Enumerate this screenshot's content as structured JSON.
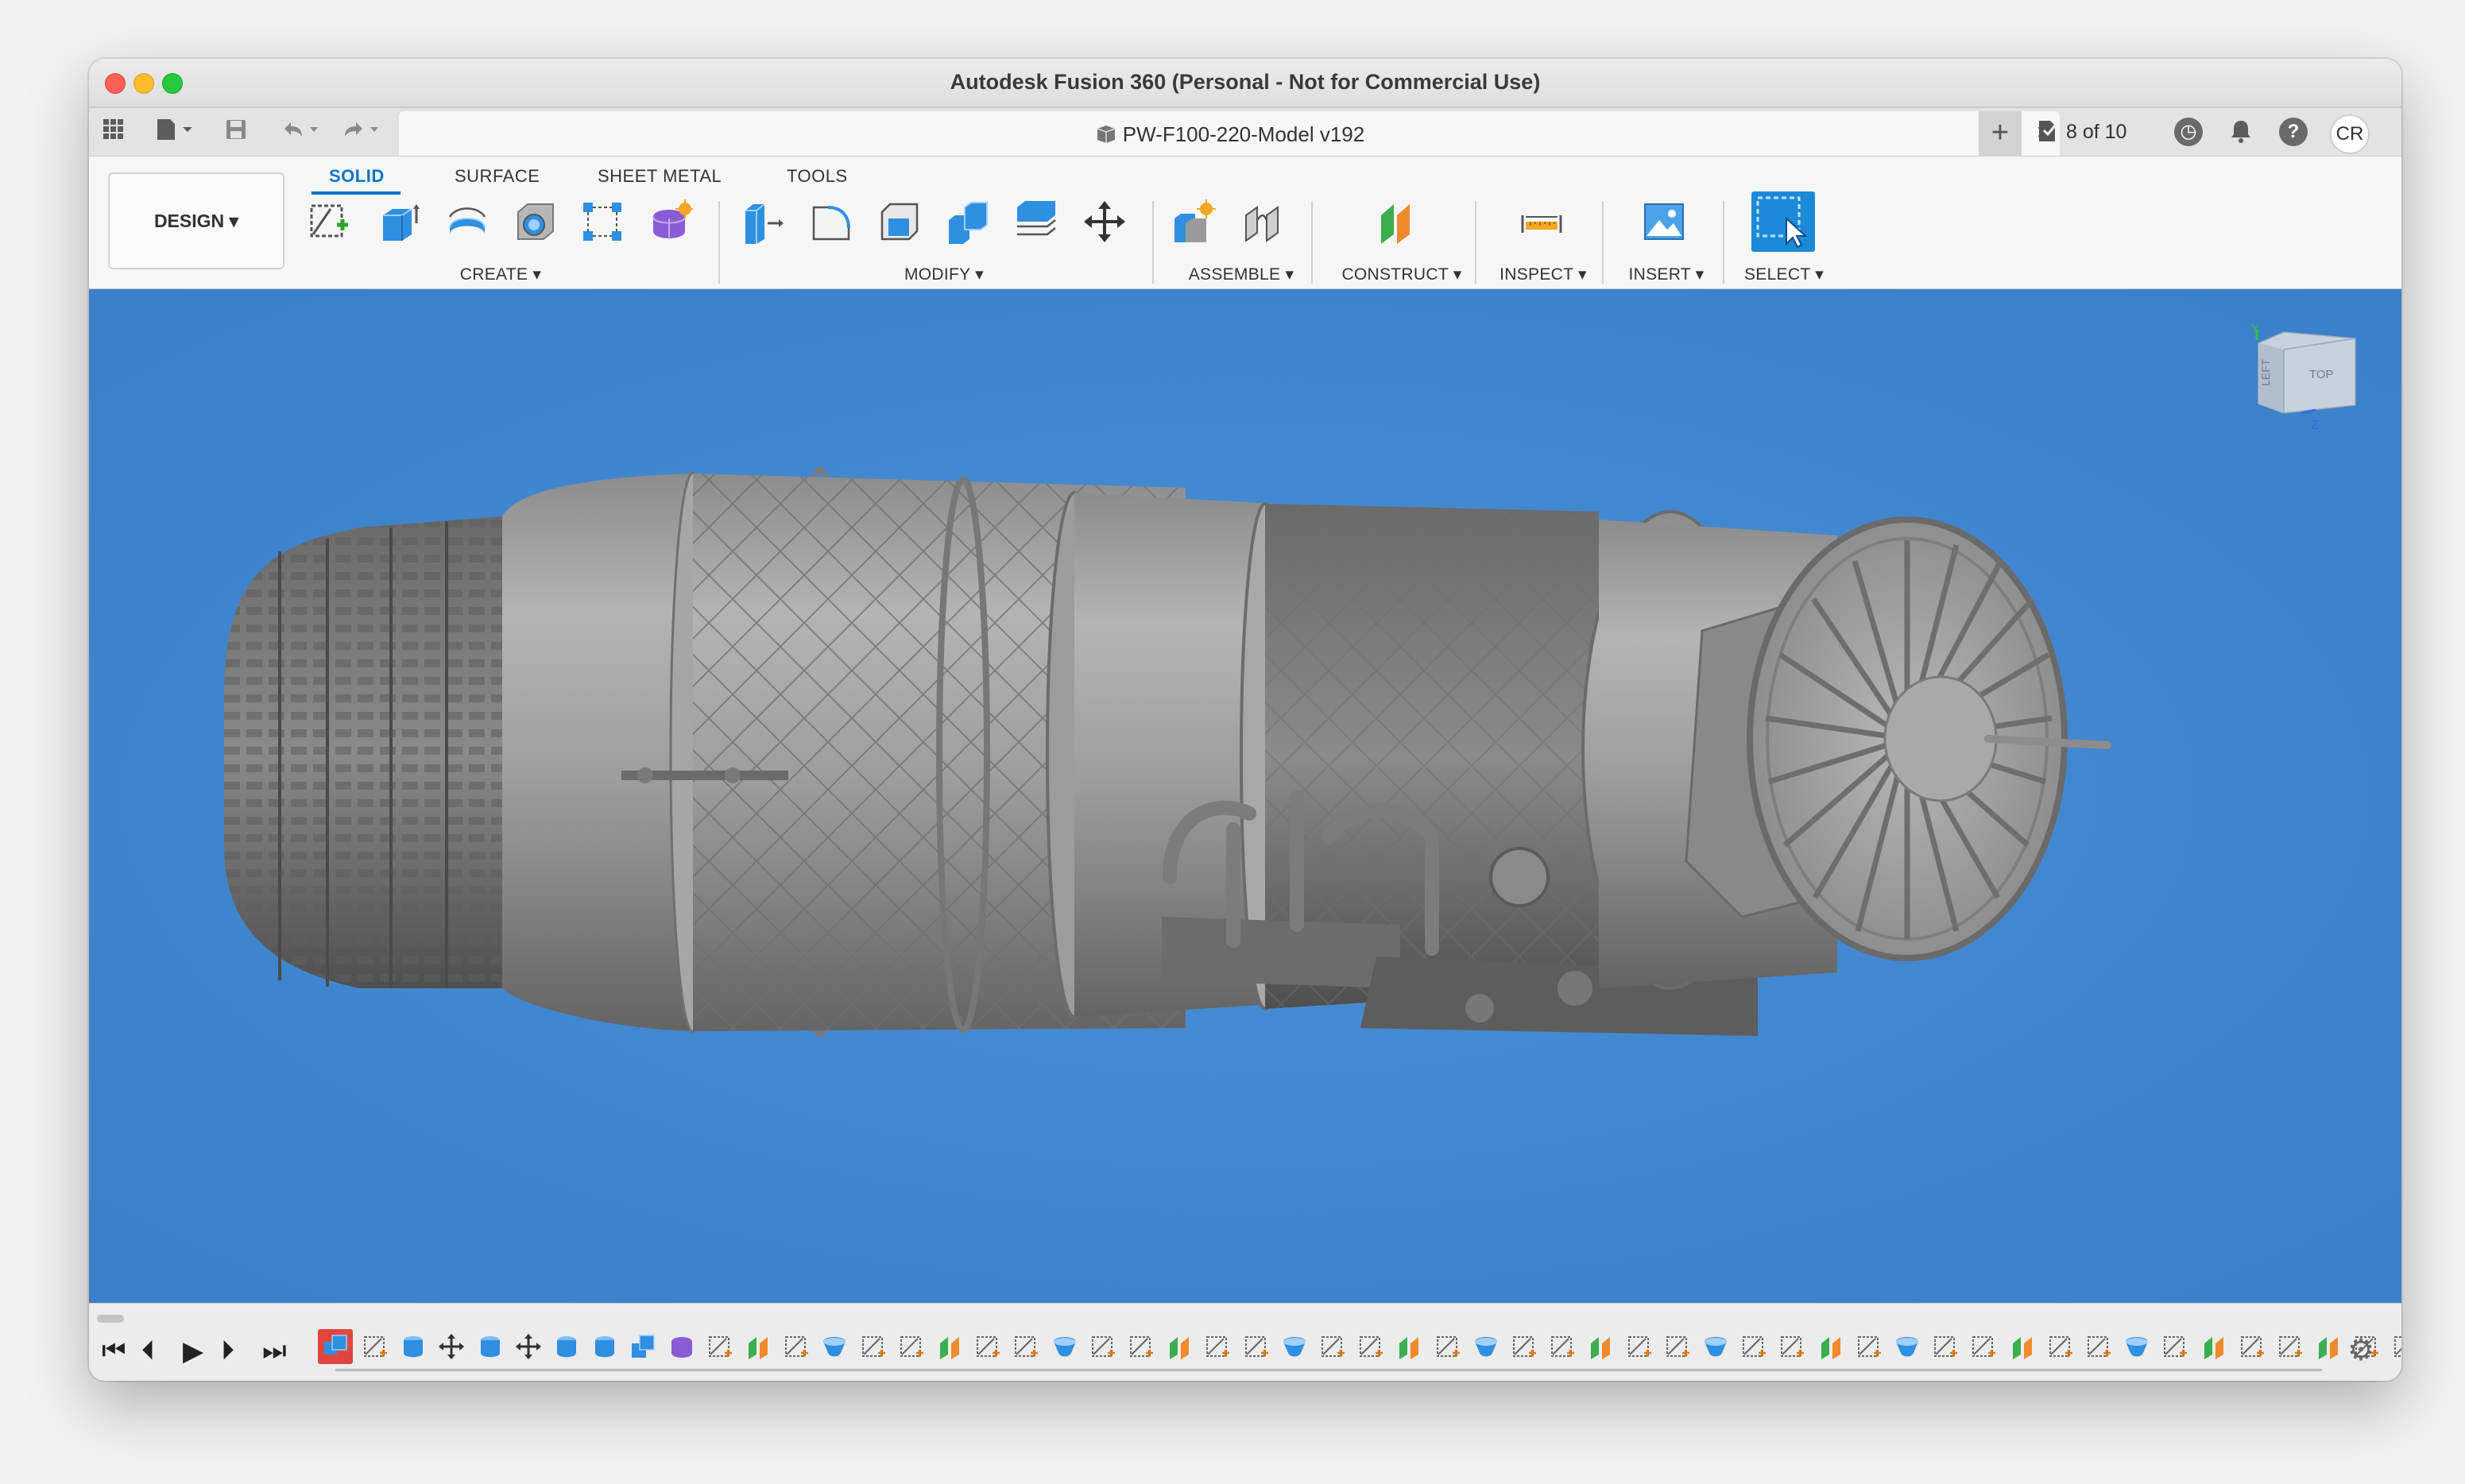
{
  "window": {
    "title": "Autodesk Fusion 360 (Personal - Not for Commercial Use)"
  },
  "tabbar": {
    "document_title": "PW-F100-220-Model v192",
    "close_icon": "×",
    "new_tab_icon": "+",
    "job_status": "8 of 10",
    "user_initials": "CR"
  },
  "ribbon": {
    "workspace": "DESIGN ▾",
    "tabs": [
      {
        "label": "SOLID",
        "active": true
      },
      {
        "label": "SURFACE",
        "active": false
      },
      {
        "label": "SHEET METAL",
        "active": false
      },
      {
        "label": "TOOLS",
        "active": false
      }
    ],
    "groups": [
      {
        "label": "CREATE ▾"
      },
      {
        "label": "MODIFY ▾"
      },
      {
        "label": "ASSEMBLE ▾"
      },
      {
        "label": "CONSTRUCT ▾"
      },
      {
        "label": "INSPECT ▾"
      },
      {
        "label": "INSERT ▾"
      },
      {
        "label": "SELECT ▾"
      }
    ]
  },
  "viewcube": {
    "left_label": "LEFT",
    "top_label": "TOP",
    "y_axis": "Y",
    "z_axis": "Z"
  },
  "colors": {
    "accent": "#0b74c8",
    "viewport": "#3f86cf",
    "feature_blue": "#2f8fe0",
    "feature_purple": "#8a5cd6"
  }
}
